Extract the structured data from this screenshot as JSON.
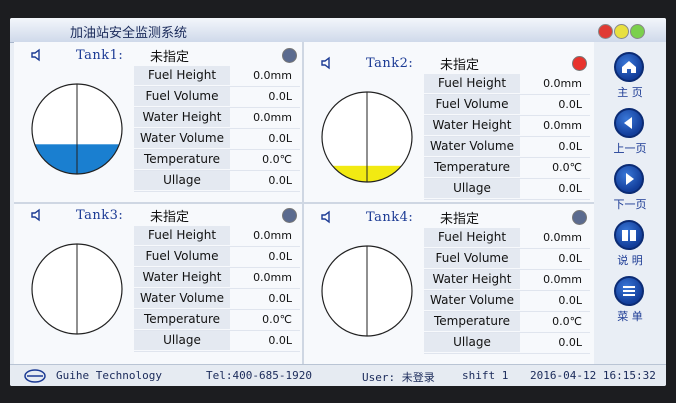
{
  "window": {
    "title": "加油站安全监测系统"
  },
  "tanks": [
    {
      "name": "Tank1:",
      "status": "未指定",
      "dot_color": "#5b6b8f",
      "level_fraction": 0.33,
      "liquid_color": "#1a7fd0",
      "rows": [
        {
          "label": "Fuel Height",
          "value": "0.0mm"
        },
        {
          "label": "Fuel Volume",
          "value": "0.0L"
        },
        {
          "label": "Water Height",
          "value": "0.0mm"
        },
        {
          "label": "Water Volume",
          "value": "0.0L"
        },
        {
          "label": "Temperature",
          "value": "0.0℃"
        },
        {
          "label": "Ullage",
          "value": "0.0L"
        }
      ]
    },
    {
      "name": "Tank2:",
      "status": "未指定",
      "dot_color": "#e8332c",
      "level_fraction": 0.18,
      "liquid_color": "#f2ea12",
      "rows": [
        {
          "label": "Fuel Height",
          "value": "0.0mm"
        },
        {
          "label": "Fuel Volume",
          "value": "0.0L"
        },
        {
          "label": "Water Height",
          "value": "0.0mm"
        },
        {
          "label": "Water Volume",
          "value": "0.0L"
        },
        {
          "label": "Temperature",
          "value": "0.0℃"
        },
        {
          "label": "Ullage",
          "value": "0.0L"
        }
      ]
    },
    {
      "name": "Tank3:",
      "status": "未指定",
      "dot_color": "#5b6b8f",
      "level_fraction": 0,
      "liquid_color": "#1a7fd0",
      "rows": [
        {
          "label": "Fuel Height",
          "value": "0.0mm"
        },
        {
          "label": "Fuel Volume",
          "value": "0.0L"
        },
        {
          "label": "Water Height",
          "value": "0.0mm"
        },
        {
          "label": "Water Volume",
          "value": "0.0L"
        },
        {
          "label": "Temperature",
          "value": "0.0℃"
        },
        {
          "label": "Ullage",
          "value": "0.0L"
        }
      ]
    },
    {
      "name": "Tank4:",
      "status": "未指定",
      "dot_color": "#5b6b8f",
      "level_fraction": 0,
      "liquid_color": "#1a7fd0",
      "rows": [
        {
          "label": "Fuel Height",
          "value": "0.0mm"
        },
        {
          "label": "Fuel Volume",
          "value": "0.0L"
        },
        {
          "label": "Water Height",
          "value": "0.0mm"
        },
        {
          "label": "Water Volume",
          "value": "0.0L"
        },
        {
          "label": "Temperature",
          "value": "0.0℃"
        },
        {
          "label": "Ullage",
          "value": "0.0L"
        }
      ]
    }
  ],
  "nav": [
    {
      "label": "主 页",
      "icon": "home-icon"
    },
    {
      "label": "上一页",
      "icon": "previous-page-icon"
    },
    {
      "label": "下一页",
      "icon": "next-page-icon"
    },
    {
      "label": "说 明",
      "icon": "book-icon"
    },
    {
      "label": "菜 单",
      "icon": "menu-list-icon"
    }
  ],
  "footer": {
    "company": "Guihe Technology",
    "tel": "Tel:400-685-1920",
    "user": "User: 未登录",
    "shift": "shift  1",
    "datetime": "2016-04-12 16:15:32"
  },
  "colors": {
    "accent": "#1b3a94",
    "nav_button": "#123d9a"
  }
}
